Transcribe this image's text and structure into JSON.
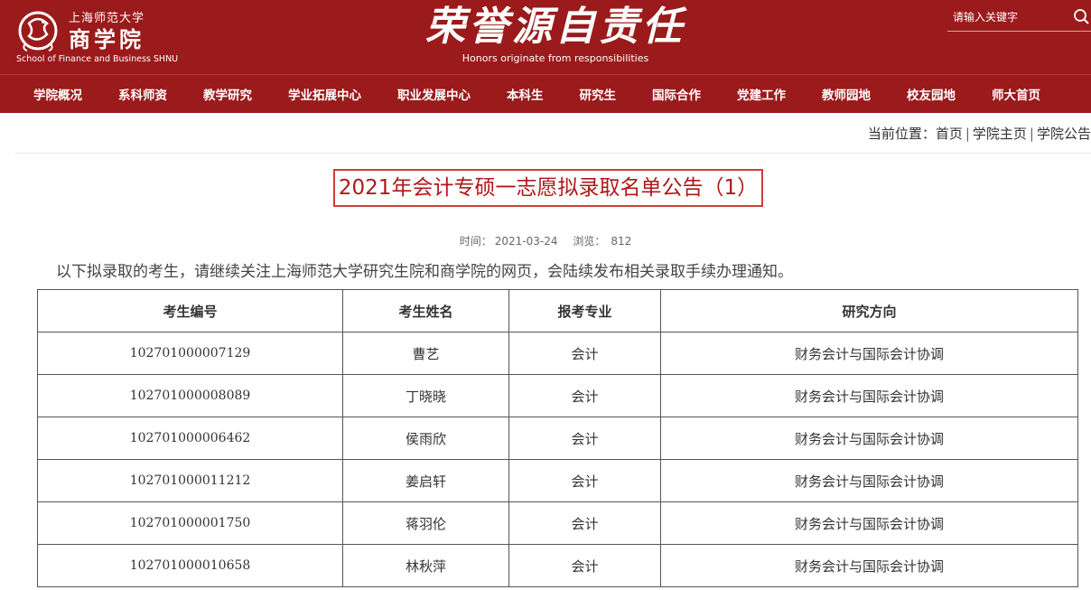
{
  "header": {
    "logo_cn_small": "上海师范大学",
    "logo_cn_big": "商学院",
    "logo_en": "School of Finance and Business SHNU",
    "slogan_cn": "荣誉源自责任",
    "slogan_en": "Honors originate from responsibilities",
    "search_placeholder": "请输入关键字",
    "brand_color": "#9b1a1b"
  },
  "nav": {
    "items": [
      "学院概况",
      "系科师资",
      "教学研究",
      "学业拓展中心",
      "职业发展中心",
      "本科生",
      "研究生",
      "国际合作",
      "党建工作",
      "教师园地",
      "校友园地",
      "师大首页"
    ]
  },
  "breadcrumb": {
    "label": "当前位置：",
    "items": [
      "首页",
      "学院主页",
      "学院公告"
    ]
  },
  "article": {
    "title": "2021年会计专硕一志愿拟录取名单公告（1）",
    "time_label": "时间：",
    "time": "2021-03-24",
    "views_label": "浏览：",
    "views": "812",
    "intro": "以下拟录取的考生，请继续关注上海师范大学研究生院和商学院的网页，会陆续发布相关录取手续办理通知。"
  },
  "table": {
    "headers": [
      "考生编号",
      "考生姓名",
      "报考专业",
      "研究方向"
    ],
    "rows": [
      [
        "102701000007129",
        "曹艺",
        "会计",
        "财务会计与国际会计协调"
      ],
      [
        "102701000008089",
        "丁晓晓",
        "会计",
        "财务会计与国际会计协调"
      ],
      [
        "102701000006462",
        "侯雨欣",
        "会计",
        "财务会计与国际会计协调"
      ],
      [
        "102701000011212",
        "姜启轩",
        "会计",
        "财务会计与国际会计协调"
      ],
      [
        "102701000001750",
        "蒋羽伦",
        "会计",
        "财务会计与国际会计协调"
      ],
      [
        "102701000010658",
        "林秋萍",
        "会计",
        "财务会计与国际会计协调"
      ]
    ]
  }
}
